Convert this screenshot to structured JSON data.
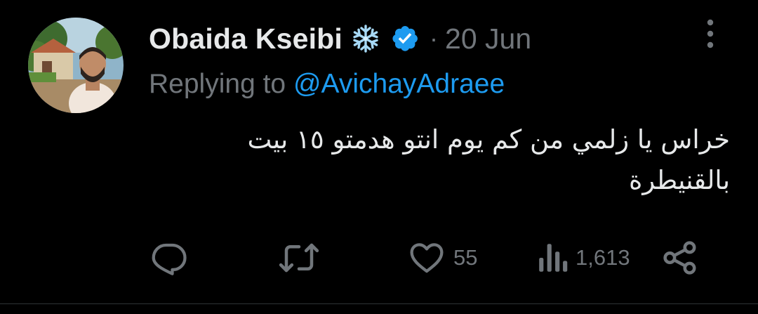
{
  "tweet": {
    "author": {
      "display_name": "Obaida Kseibi",
      "badge_icon": "snowflake-icon",
      "verified_icon": "verified-badge-icon",
      "separator": "·",
      "date": "20 Jun"
    },
    "reply": {
      "prefix": "Replying to",
      "handle": "@AvichayAdraee"
    },
    "text": "خراس يا زلمي من كم يوم انتو هدمتو ١٥ بيت بالقنيطرة",
    "actions": {
      "reply_icon": "reply-bubble-icon",
      "retweet_icon": "retweet-icon",
      "like_icon": "heart-icon",
      "like_count": "55",
      "views_icon": "views-chart-icon",
      "views_count": "1,613",
      "share_icon": "share-icon"
    },
    "colors": {
      "background": "#000000",
      "primary_text": "#e7e9ea",
      "secondary_text": "#71767b",
      "link": "#1d9bf0",
      "verified": "#1d9bf0",
      "snowflake": "#a6d8f5"
    }
  }
}
